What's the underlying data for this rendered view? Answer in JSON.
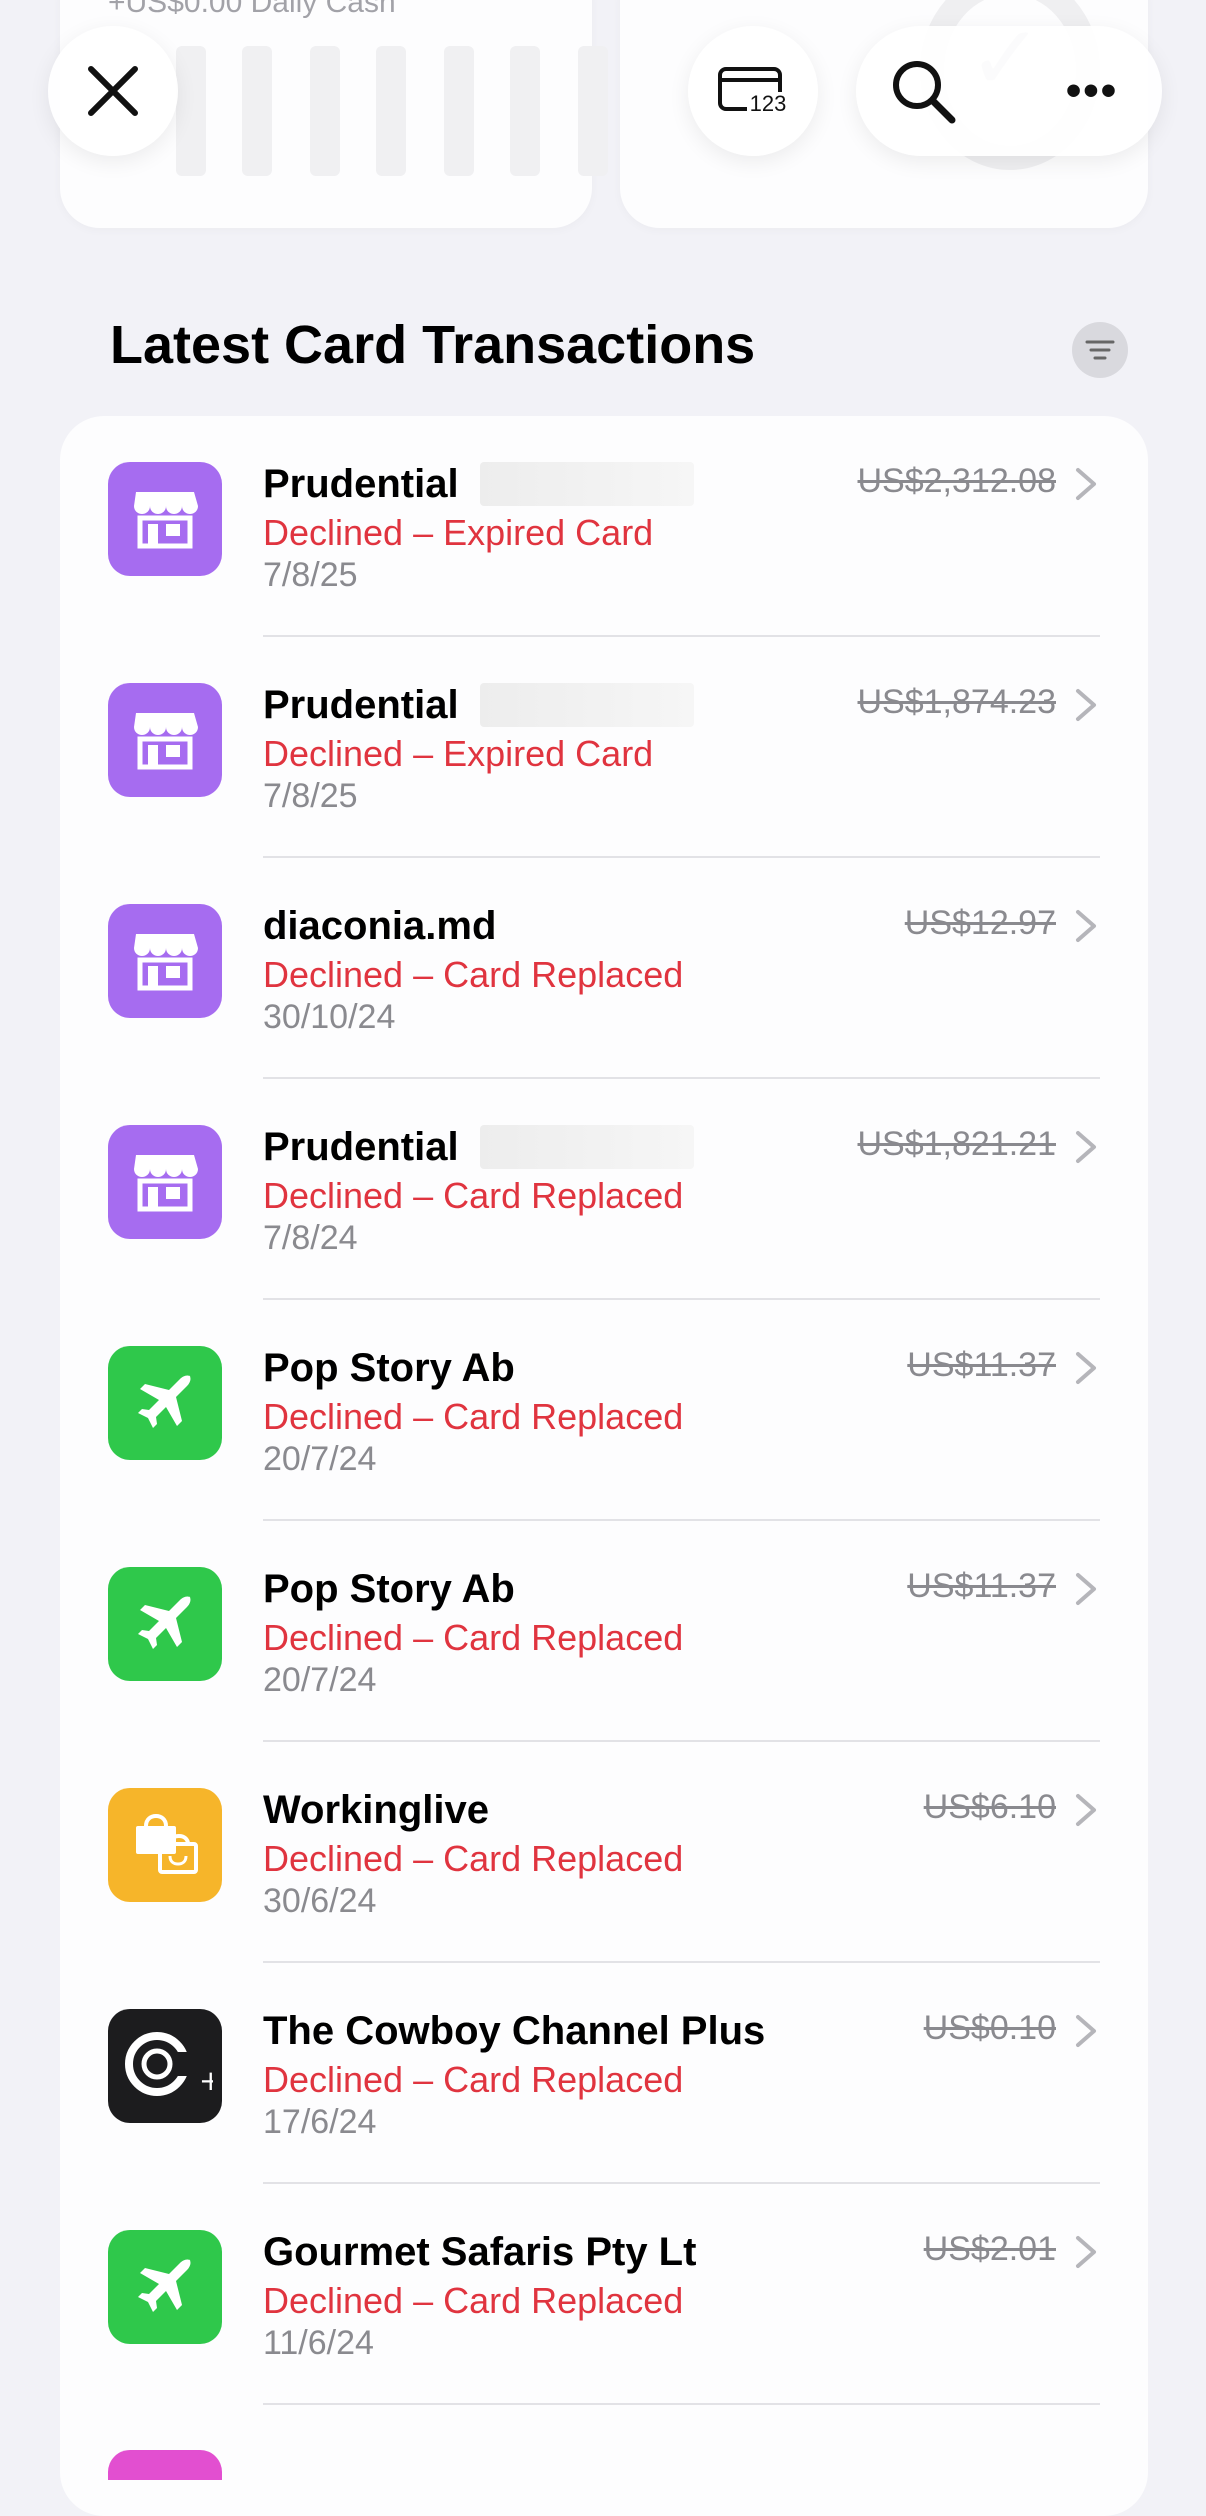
{
  "top_cards": {
    "daily_cash": "+US$0.00 Daily Cash"
  },
  "toolbar": {
    "close_icon": "close-icon",
    "card_number_icon": "card-number-icon",
    "card_number_text": "123",
    "search_icon": "search-icon",
    "more_icon": "ellipsis-icon",
    "more_text": "•••"
  },
  "section": {
    "title": "Latest Card Transactions",
    "filter_icon": "filter-icon"
  },
  "colors": {
    "declined_red": "#e0343f",
    "purple": "#a66cf0",
    "green": "#2fc84b",
    "yellow": "#f6b52a",
    "black": "#1c1c1e"
  },
  "transactions": [
    {
      "merchant": "Prudential",
      "redacted": true,
      "status": "Declined – Expired Card",
      "date": "7/8/25",
      "amount": "US$2,312.08",
      "icon": "store-icon",
      "color": "#a66cf0"
    },
    {
      "merchant": "Prudential",
      "redacted": true,
      "status": "Declined – Expired Card",
      "date": "7/8/25",
      "amount": "US$1,874.23",
      "icon": "store-icon",
      "color": "#a66cf0"
    },
    {
      "merchant": "diaconia.md",
      "redacted": false,
      "status": "Declined – Card Replaced",
      "date": "30/10/24",
      "amount": "US$12.97",
      "icon": "store-icon",
      "color": "#a66cf0"
    },
    {
      "merchant": "Prudential",
      "redacted": true,
      "status": "Declined – Card Replaced",
      "date": "7/8/24",
      "amount": "US$1,821.21",
      "icon": "store-icon",
      "color": "#a66cf0"
    },
    {
      "merchant": "Pop Story Ab",
      "redacted": false,
      "status": "Declined – Card Replaced",
      "date": "20/7/24",
      "amount": "US$11.37",
      "icon": "airplane-icon",
      "color": "#2fc84b"
    },
    {
      "merchant": "Pop Story Ab",
      "redacted": false,
      "status": "Declined – Card Replaced",
      "date": "20/7/24",
      "amount": "US$11.37",
      "icon": "airplane-icon",
      "color": "#2fc84b"
    },
    {
      "merchant": "Workinglive",
      "redacted": false,
      "status": "Declined – Card Replaced",
      "date": "30/6/24",
      "amount": "US$6.10",
      "icon": "shopping-bag-icon",
      "color": "#f6b52a"
    },
    {
      "merchant": "The Cowboy Channel Plus",
      "redacted": false,
      "status": "Declined – Card Replaced",
      "date": "17/6/24",
      "amount": "US$0.10",
      "icon": "cowboy-channel-logo-icon",
      "color": "#1c1c1e"
    },
    {
      "merchant": "Gourmet Safaris Pty Lt",
      "redacted": false,
      "status": "Declined – Card Replaced",
      "date": "11/6/24",
      "amount": "US$2.01",
      "icon": "airplane-icon",
      "color": "#2fc84b"
    }
  ]
}
